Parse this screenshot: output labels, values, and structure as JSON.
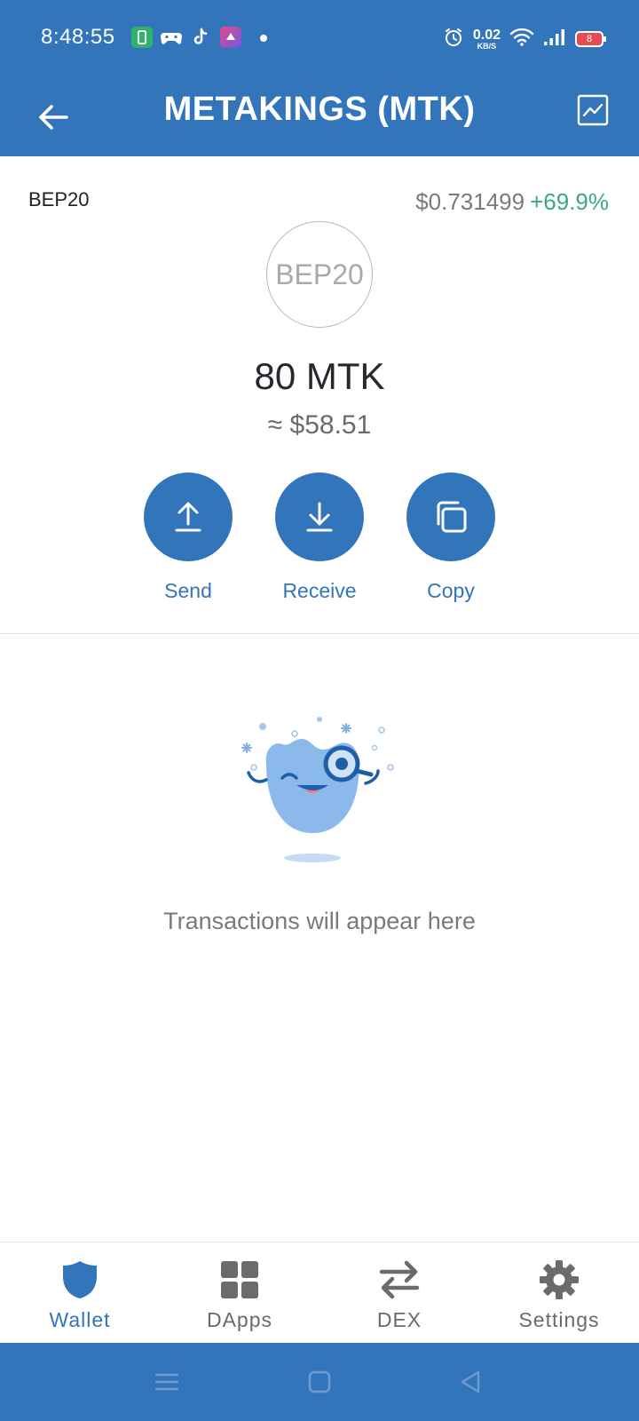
{
  "status_bar": {
    "time": "8:48:55",
    "net_speed_value": "0.02",
    "net_speed_unit": "KB/S",
    "battery": "8"
  },
  "app_bar": {
    "title": "METAKINGS (MTK)"
  },
  "token": {
    "network": "BEP20",
    "logo_text": "BEP20",
    "price": "$0.731499",
    "change": "+69.9%",
    "balance": "80 MTK",
    "fiat_value": "≈ $58.51"
  },
  "actions": [
    {
      "label": "Send",
      "icon": "upload-icon"
    },
    {
      "label": "Receive",
      "icon": "download-icon"
    },
    {
      "label": "Copy",
      "icon": "copy-icon"
    }
  ],
  "empty_state": {
    "message": "Transactions will appear here"
  },
  "tabs": [
    {
      "label": "Wallet",
      "icon": "shield-icon",
      "active": true
    },
    {
      "label": "DApps",
      "icon": "grid-icon",
      "active": false
    },
    {
      "label": "DEX",
      "icon": "swap-icon",
      "active": false
    },
    {
      "label": "Settings",
      "icon": "gear-icon",
      "active": false
    }
  ],
  "colors": {
    "primary": "#3375bb",
    "positive": "#3aa981",
    "muted_text": "#7a7a7a"
  }
}
